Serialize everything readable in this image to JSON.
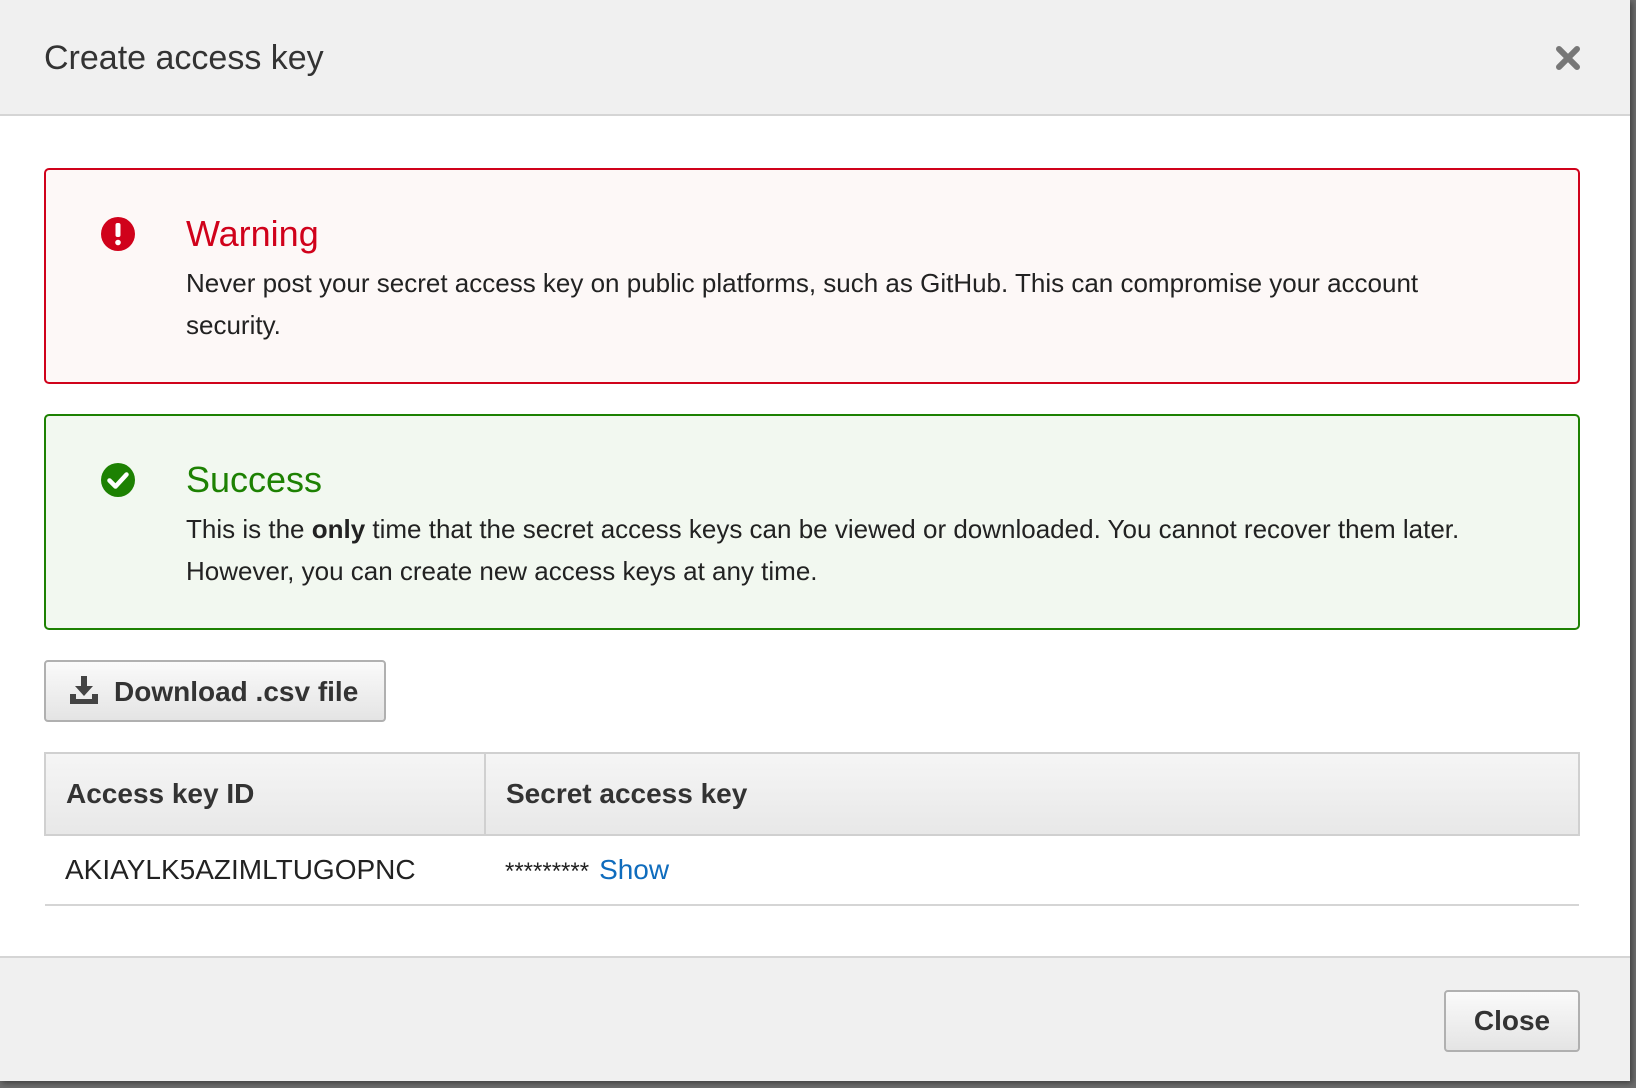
{
  "dialog": {
    "title": "Create access key"
  },
  "warning": {
    "heading": "Warning",
    "body": "Never post your secret access key on public platforms, such as GitHub. This can compromise your account security.",
    "color": "#d0021b",
    "icon": "exclamation-circle-icon"
  },
  "success": {
    "heading": "Success",
    "body_before": "This is the ",
    "body_bold": "only",
    "body_after": " time that the secret access keys can be viewed or downloaded. You cannot recover them later. However, you can create new access keys at any time.",
    "color": "#1d8102",
    "icon": "check-circle-icon"
  },
  "download": {
    "label": "Download .csv file",
    "icon": "download-icon"
  },
  "table": {
    "headers": [
      "Access key ID",
      "Secret access key"
    ],
    "rows": [
      {
        "access_key_id": "AKIAYLK5AZIMLTUGOPNC",
        "secret_masked": "*********",
        "show_label": "Show"
      }
    ]
  },
  "footer": {
    "close_label": "Close"
  },
  "colors": {
    "link": "#0f6cbd",
    "header_bg": "#f0f0f0"
  }
}
